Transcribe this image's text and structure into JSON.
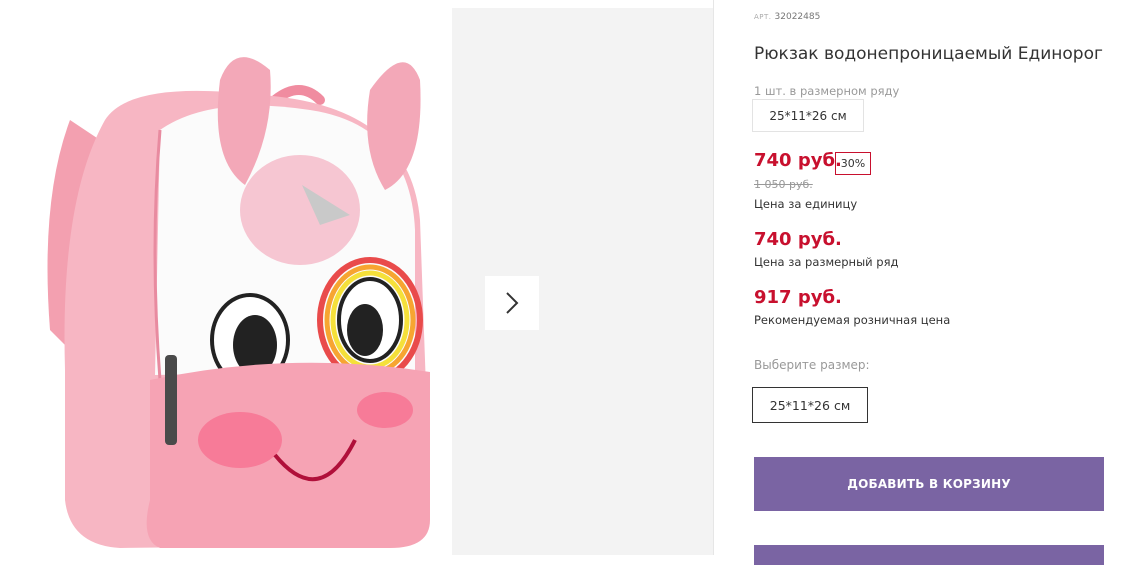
{
  "product": {
    "sku_label": "АРТ.",
    "sku": "32022485",
    "title": "Рюкзак водонепроницаемый Единорог",
    "pack_caption": "1 шт. в размерном ряду",
    "pack_size": "25*11*26 см",
    "price": "740 руб.",
    "discount": "30%",
    "old_price": "1 050 руб.",
    "unit_price_caption": "Цена за единицу",
    "row_price": "740 руб.",
    "row_price_caption": "Цена за размерный ряд",
    "retail_price": "917 руб.",
    "retail_price_caption": "Рекомендуемая розничная цена",
    "size_prompt": "Выберите размер:",
    "size_option": "25*11*26 см",
    "add_to_cart": "ДОБАВИТЬ В КОРЗИНУ"
  },
  "colors": {
    "accent": "#7a64a3",
    "price_red": "#c8102e"
  },
  "icons": {
    "next": "chevron-right-icon"
  }
}
